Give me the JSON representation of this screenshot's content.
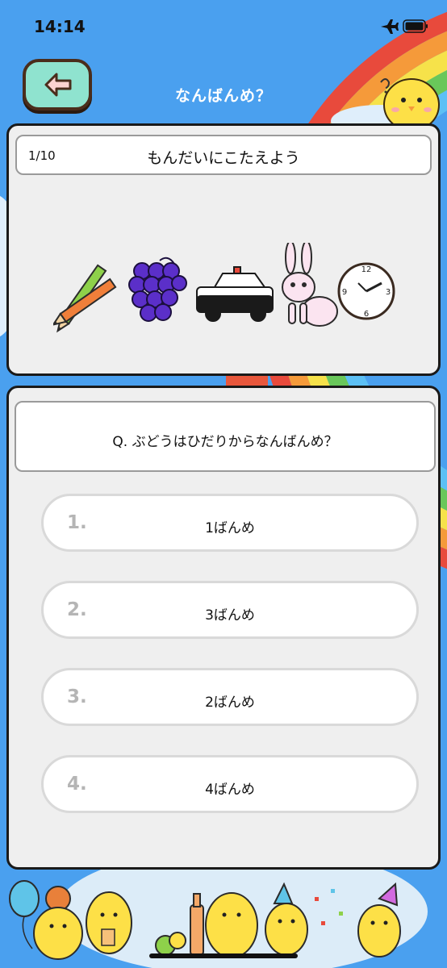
{
  "status_bar": {
    "time": "14:14"
  },
  "header": {
    "title": "なんばんめ？"
  },
  "quiz": {
    "counter": "1/10",
    "instruction": "もんだいにこたえよう",
    "items": [
      "pencils-icon",
      "grapes-icon",
      "police-car-icon",
      "rabbit-icon",
      "clock-icon"
    ]
  },
  "question": {
    "text": "Q. ぶどうはひだりからなんばんめ？"
  },
  "answers": [
    {
      "number": "1.",
      "label": "1ばんめ"
    },
    {
      "number": "2.",
      "label": "3ばんめ"
    },
    {
      "number": "3.",
      "label": "2ばんめ"
    },
    {
      "number": "4.",
      "label": "4ばんめ"
    }
  ],
  "colors": {
    "background": "#4aa0ef",
    "card": "#efefef",
    "back_button": "#8fe3cf",
    "chick": "#fde047"
  }
}
